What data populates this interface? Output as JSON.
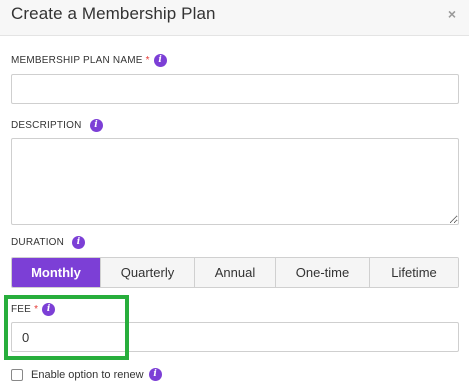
{
  "dialog": {
    "title": "Create a Membership Plan",
    "close_glyph": "×"
  },
  "fields": {
    "name": {
      "label": "MEMBERSHIP PLAN NAME",
      "required_mark": "*",
      "value": ""
    },
    "description": {
      "label": "DESCRIPTION",
      "value": ""
    },
    "duration": {
      "label": "DURATION",
      "options": [
        "Monthly",
        "Quarterly",
        "Annual",
        "One-time",
        "Lifetime"
      ],
      "selected": "Monthly"
    },
    "fee": {
      "label": "FEE",
      "required_mark": "*",
      "value": "0"
    },
    "renew": {
      "label": "Enable option to renew",
      "checked": false
    }
  },
  "icons": {
    "info": "i",
    "info_color": "#7c3fd6"
  },
  "colors": {
    "accent": "#7c3fd6",
    "highlight": "#27ae3c",
    "required": "#e53935"
  }
}
